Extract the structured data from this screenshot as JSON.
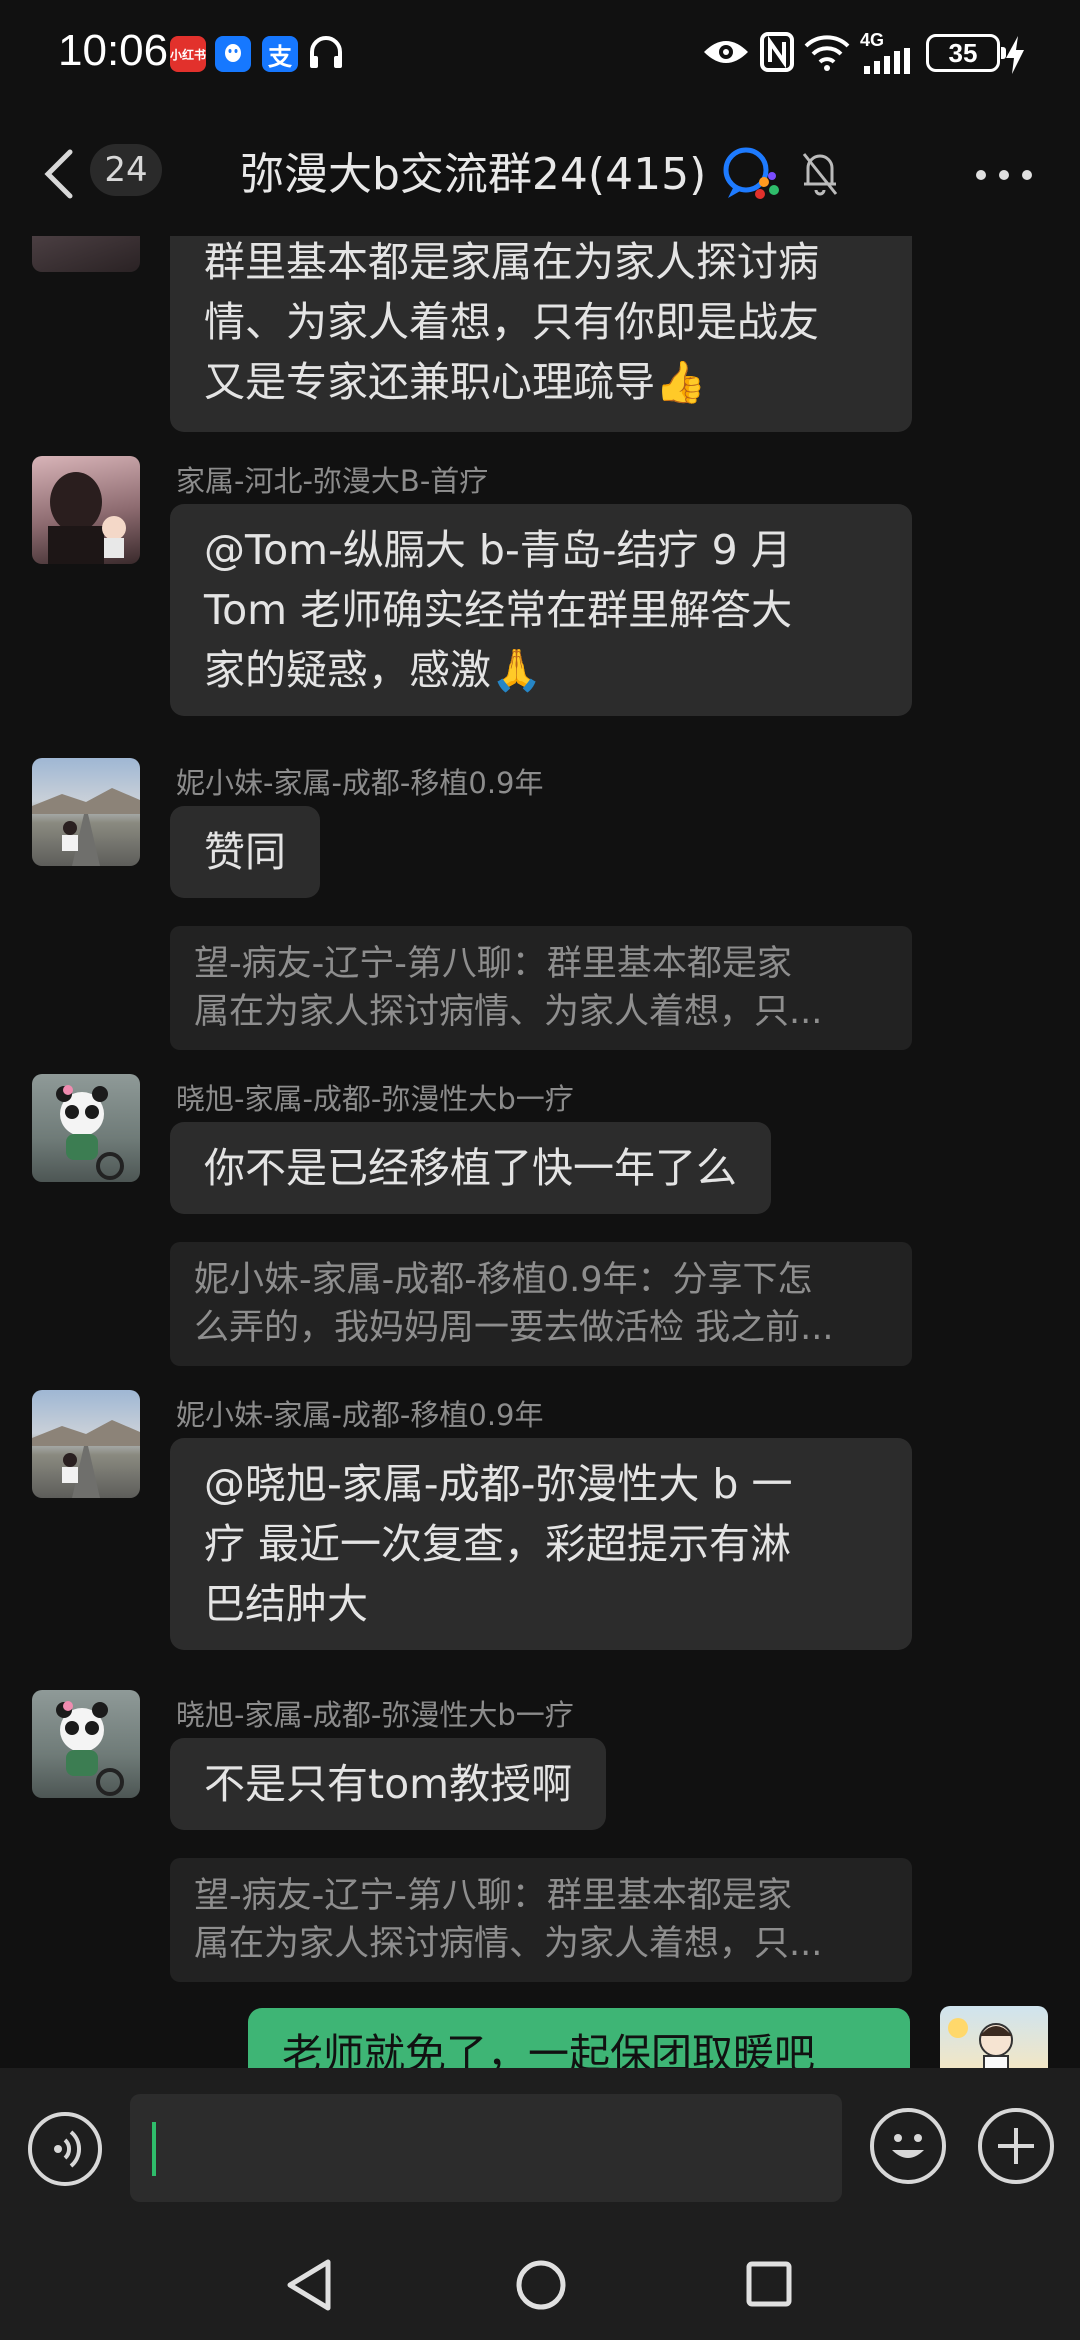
{
  "status_bar": {
    "time": "10:06",
    "apps": [
      "小红书",
      "支"
    ],
    "network": "4G",
    "battery": "35"
  },
  "header": {
    "unread_count": "24",
    "title": "弥漫大b交流群24(415)"
  },
  "messages": [
    {
      "text_lines": [
        "群里基本都是家属在为家人探讨病",
        "情、为家人着想，只有你即是战友",
        "又是专家还兼职心理疏导👍"
      ]
    },
    {
      "sender": "家属-河北-弥漫大B-首疗",
      "text_lines": [
        "@Tom-纵膈大 b-青岛-结疗 9 月",
        " Tom 老师确实经常在群里解答大",
        "家的疑惑，感激🙏"
      ]
    },
    {
      "sender": "妮小妹-家属-成都-移植0.9年",
      "text_lines": [
        "赞同"
      ],
      "quote_lines": [
        "望-病友-辽宁-第八聊：群里基本都是家",
        "属在为家人探讨病情、为家人着想，只..."
      ]
    },
    {
      "sender": "晓旭-家属-成都-弥漫性大b一疗",
      "text_lines": [
        "你不是已经移植了快一年了么"
      ],
      "quote_lines": [
        "妮小妹-家属-成都-移植0.9年：分享下怎",
        "么弄的，我妈妈周一要去做活检 我之前..."
      ]
    },
    {
      "sender": "妮小妹-家属-成都-移植0.9年",
      "text_lines": [
        "@晓旭-家属-成都-弥漫性大 b 一",
        "疗  最近一次复查，彩超提示有淋",
        "巴结肿大"
      ]
    },
    {
      "sender": "晓旭-家属-成都-弥漫性大b一疗",
      "text_lines": [
        "不是只有tom教授啊"
      ],
      "quote_lines": [
        "望-病友-辽宁-第八聊：群里基本都是家",
        "属在为家人探讨病情、为家人着想，只..."
      ]
    },
    {
      "text_lines": [
        "老师就免了，一起保团取暖吧"
      ]
    }
  ],
  "colors": {
    "background": "#111111",
    "bubble_other": "#2c2c2c",
    "bubble_mine": "#3eb575",
    "caret": "#2fbd6b"
  }
}
